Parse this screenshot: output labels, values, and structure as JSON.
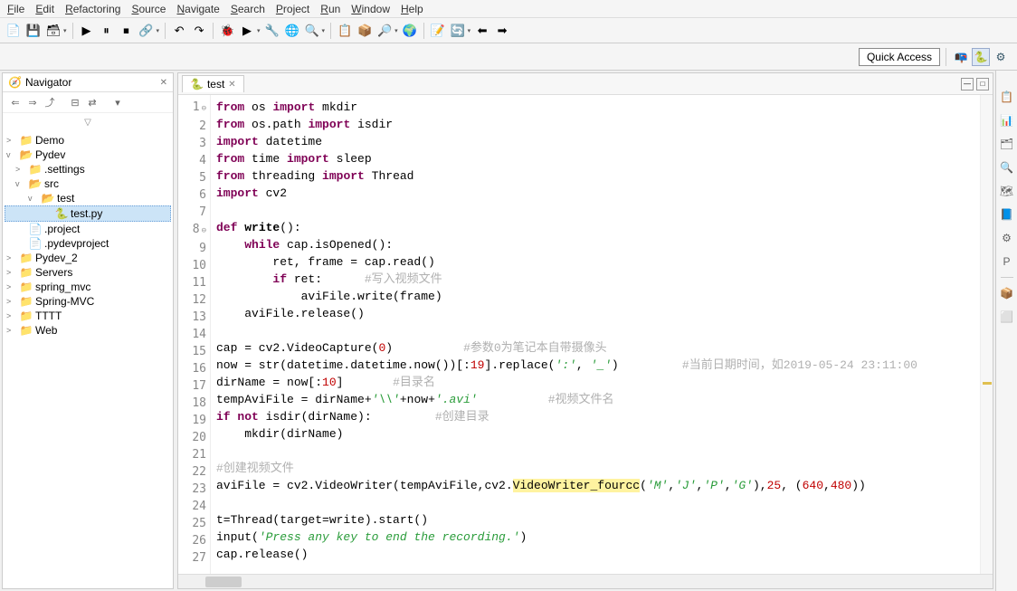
{
  "menu": [
    "File",
    "Edit",
    "Refactoring",
    "Source",
    "Navigate",
    "Search",
    "Project",
    "Run",
    "Window",
    "Help"
  ],
  "quick_access": "Quick Access",
  "navigator": {
    "title": "Navigator",
    "dd_icon": "▽",
    "tree": [
      {
        "lvl": 0,
        "tw": ">",
        "icon": "📁",
        "cls": "proj",
        "label": "Demo"
      },
      {
        "lvl": 0,
        "tw": "v",
        "icon": "📂",
        "cls": "folder-open",
        "label": "Pydev"
      },
      {
        "lvl": 1,
        "tw": ">",
        "icon": "📁",
        "cls": "folder",
        "label": ".settings"
      },
      {
        "lvl": 1,
        "tw": "v",
        "icon": "📂",
        "cls": "folder-open",
        "label": "src"
      },
      {
        "lvl": 2,
        "tw": "v",
        "icon": "📂",
        "cls": "folder-open",
        "label": "test"
      },
      {
        "lvl": 3,
        "tw": "",
        "icon": "🐍",
        "cls": "pyfile",
        "label": "test.py",
        "sel": true
      },
      {
        "lvl": 1,
        "tw": "",
        "icon": "📄",
        "cls": "xfile",
        "label": ".project"
      },
      {
        "lvl": 1,
        "tw": "",
        "icon": "📄",
        "cls": "xfile",
        "label": ".pydevproject"
      },
      {
        "lvl": 0,
        "tw": ">",
        "icon": "📁",
        "cls": "proj",
        "label": "Pydev_2"
      },
      {
        "lvl": 0,
        "tw": ">",
        "icon": "📁",
        "cls": "proj",
        "label": "Servers"
      },
      {
        "lvl": 0,
        "tw": ">",
        "icon": "📁",
        "cls": "proj",
        "label": "spring_mvc"
      },
      {
        "lvl": 0,
        "tw": ">",
        "icon": "📁",
        "cls": "proj",
        "label": "Spring-MVC"
      },
      {
        "lvl": 0,
        "tw": ">",
        "icon": "📁",
        "cls": "proj",
        "label": "TTTT"
      },
      {
        "lvl": 0,
        "tw": ">",
        "icon": "📁",
        "cls": "proj",
        "label": "Web"
      }
    ]
  },
  "editor": {
    "tab_label": "test",
    "lines": [
      {
        "n": 1,
        "fold": "⊖",
        "html": "<span class='kw'>from</span> os <span class='kw'>import</span> mkdir"
      },
      {
        "n": 2,
        "html": "<span class='kw'>from</span> os.path <span class='kw'>import</span> isdir"
      },
      {
        "n": 3,
        "html": "<span class='kw'>import</span> datetime"
      },
      {
        "n": 4,
        "html": "<span class='kw'>from</span> time <span class='kw'>import</span> sleep"
      },
      {
        "n": 5,
        "html": "<span class='kw'>from</span> threading <span class='kw'>import</span> Thread"
      },
      {
        "n": 6,
        "html": "<span class='kw'>import</span> cv2"
      },
      {
        "n": 7,
        "html": ""
      },
      {
        "n": 8,
        "fold": "⊖",
        "html": "<span class='kw'>def</span> <span class='fn'>write</span>():"
      },
      {
        "n": 9,
        "html": "    <span class='kw'>while</span> cap.isOpened():"
      },
      {
        "n": 10,
        "html": "        ret, frame = cap.read()"
      },
      {
        "n": 11,
        "html": "        <span class='kw'>if</span> ret:      <span class='cmt'>#写入视频文件</span>"
      },
      {
        "n": 12,
        "html": "            aviFile.write(frame)"
      },
      {
        "n": 13,
        "html": "    aviFile.release()"
      },
      {
        "n": 14,
        "html": ""
      },
      {
        "n": 15,
        "html": "cap = cv2.VideoCapture(<span class='num'>0</span>)          <span class='cmt'>#参数0为笔记本自带摄像头</span>"
      },
      {
        "n": 16,
        "html": "now = str(datetime.datetime.now())[:<span class='num'>19</span>].replace(<span class='str'>':'</span>, <span class='str'>'_'</span>)         <span class='cmt'>#当前日期时间，如2019-05-24 23:11:00</span>"
      },
      {
        "n": 17,
        "html": "dirName = now[:<span class='num'>10</span>]       <span class='cmt'>#目录名</span>"
      },
      {
        "n": 18,
        "html": "tempAviFile = dirName+<span class='str'>'\\\\'</span>+now+<span class='str'>'.avi'</span>          <span class='cmt'>#视频文件名</span>"
      },
      {
        "n": 19,
        "html": "<span class='kw'>if not</span> isdir(dirName):         <span class='cmt'>#创建目录</span>"
      },
      {
        "n": 20,
        "html": "    mkdir(dirName)"
      },
      {
        "n": 21,
        "html": ""
      },
      {
        "n": 22,
        "html": "<span class='cmt'>#创建视频文件</span>"
      },
      {
        "n": 23,
        "html": "aviFile = cv2.VideoWriter(tempAviFile,cv2.<span class='hl'>VideoWriter_fourcc</span>(<span class='str'>'M'</span>,<span class='str'>'J'</span>,<span class='str'>'P'</span>,<span class='str'>'G'</span>),<span class='num'>25</span>, (<span class='num'>640</span>,<span class='num'>480</span>))"
      },
      {
        "n": 24,
        "html": ""
      },
      {
        "n": 25,
        "html": "t=Thread(target=write).start()"
      },
      {
        "n": 26,
        "html": "input(<span class='str'>'Press any key to end the recording.'</span>)"
      },
      {
        "n": 27,
        "html": "cap.release()"
      }
    ]
  },
  "toolbar_icons": [
    "📄",
    "💾",
    "🗃",
    "▶",
    "⏸",
    "⏹",
    "🔗",
    "↶",
    "↷",
    "🐞",
    "▶",
    "🔧",
    "🌐",
    "🔍",
    "📋",
    "📦",
    "🔎",
    "🌍",
    "📝",
    "🔄",
    "⬅",
    "➡"
  ],
  "tray_icons": [
    "📋",
    "📊",
    "🗂",
    "🔍",
    "🗺",
    "📘",
    "⚙",
    "P",
    "📦",
    "⬜"
  ]
}
